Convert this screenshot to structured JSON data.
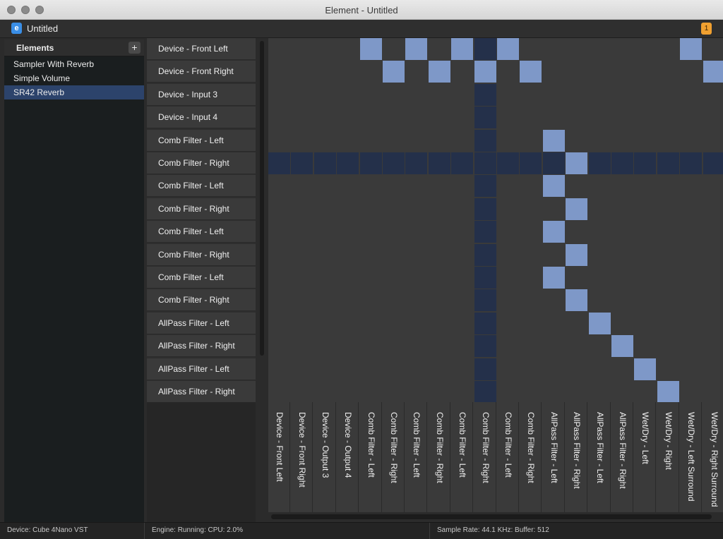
{
  "window": {
    "title": "Element - Untitled"
  },
  "toolbar": {
    "session_name": "Untitled",
    "app_icon_glyph": "e",
    "notification_count": "1"
  },
  "sidebar": {
    "title": "Elements",
    "add_label": "+",
    "items": [
      {
        "label": "Sampler With Reverb",
        "selected": false
      },
      {
        "label": "Simple Volume",
        "selected": false
      },
      {
        "label": "SR42 Reverb",
        "selected": true
      }
    ]
  },
  "matrix": {
    "rows": [
      "Device - Front Left",
      "Device - Front Right",
      "Device - Input 3",
      "Device - Input 4",
      "Comb Filter - Left",
      "Comb Filter - Right",
      "Comb Filter - Left",
      "Comb Filter - Right",
      "Comb Filter - Left",
      "Comb Filter - Right",
      "Comb Filter - Left",
      "Comb Filter - Right",
      "AllPass Filter - Left",
      "AllPass Filter - Right",
      "AllPass Filter - Left",
      "AllPass Filter - Right"
    ],
    "columns": [
      "Device - Front Left",
      "Device - Front Right",
      "Device - Output 3",
      "Device - Output 4",
      "Comb Filter - Left",
      "Comb Filter - Right",
      "Comb Filter - Left",
      "Comb Filter - Right",
      "Comb Filter - Left",
      "Comb Filter - Right",
      "Comb Filter - Left",
      "Comb Filter - Right",
      "AllPass Filter - Left",
      "AllPass Filter - Right",
      "AllPass Filter - Left",
      "AllPass Filter - Right",
      "Wet/Dry - Left",
      "Wet/Dry - Right",
      "Wet/Dry - Left Surround",
      "Wet/Dry - Right Surround"
    ],
    "highlighted_row": 5,
    "highlighted_column": 9,
    "connections": [
      [
        0,
        4
      ],
      [
        0,
        6
      ],
      [
        0,
        8
      ],
      [
        0,
        10
      ],
      [
        0,
        18
      ],
      [
        1,
        5
      ],
      [
        1,
        7
      ],
      [
        1,
        9
      ],
      [
        1,
        11
      ],
      [
        1,
        19
      ],
      [
        4,
        12
      ],
      [
        5,
        13
      ],
      [
        6,
        12
      ],
      [
        7,
        13
      ],
      [
        8,
        12
      ],
      [
        9,
        13
      ],
      [
        10,
        12
      ],
      [
        11,
        13
      ],
      [
        12,
        14
      ],
      [
        13,
        15
      ],
      [
        14,
        16
      ],
      [
        15,
        17
      ]
    ]
  },
  "status": {
    "device": "Device: Cube 4Nano VST",
    "engine": "Engine: Running:  CPU: 2.0%",
    "audio": "Sample Rate: 44.1 KHz:  Buffer: 512"
  }
}
